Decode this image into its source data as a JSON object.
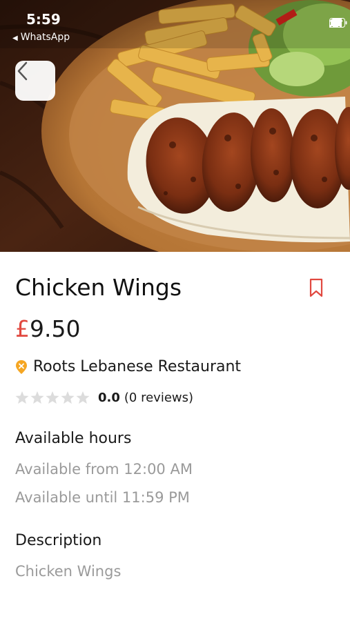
{
  "status_bar": {
    "time": "5:59",
    "back_app": "WhatsApp",
    "icons": [
      "signal-icon",
      "wifi-icon",
      "battery-icon"
    ]
  },
  "header": {
    "back_button_icon": "chevron-left-icon"
  },
  "item": {
    "title": "Chicken Wings",
    "currency": "£",
    "price": "9.50",
    "restaurant": "Roots Lebanese Restaurant",
    "rating_value": "0.0",
    "review_count": "(0 reviews)",
    "stars_filled": 0,
    "stars_total": 5
  },
  "hours": {
    "heading": "Available hours",
    "from": "Available from 12:00 AM",
    "until": "Available until 11:59 PM"
  },
  "description": {
    "heading": "Description",
    "text": "Chicken Wings"
  },
  "colors": {
    "accent": "#e1483f",
    "pin": "#f5a623",
    "muted_text": "#9a9a9a",
    "star_empty": "#dcdcdc"
  }
}
